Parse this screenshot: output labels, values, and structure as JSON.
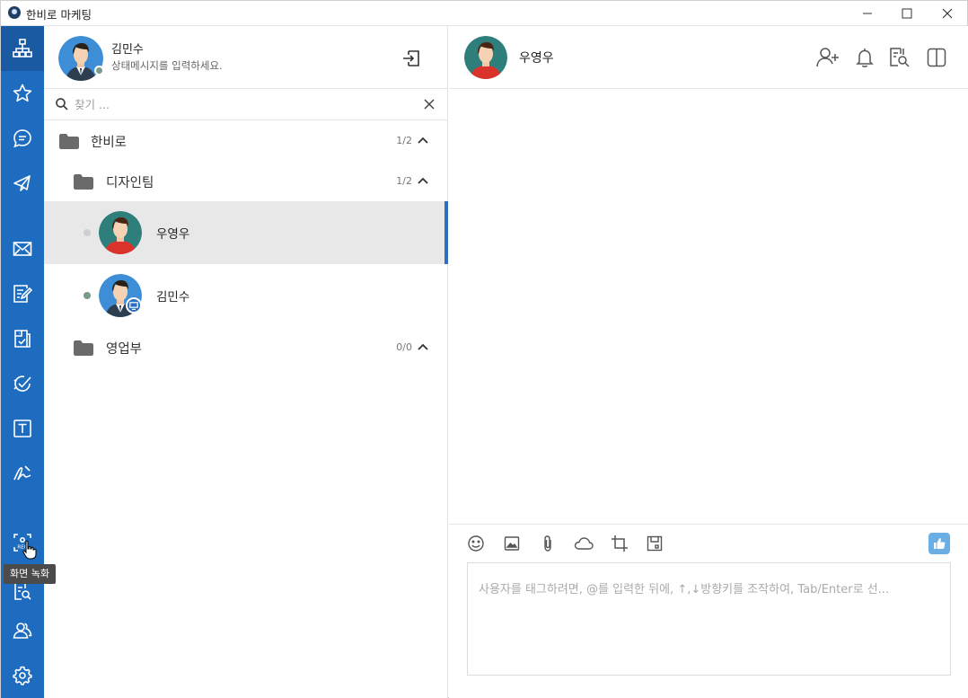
{
  "window": {
    "title": "한비로 마케팅",
    "controls": [
      "minimize-icon",
      "maximize-icon",
      "close-icon"
    ]
  },
  "rail": {
    "items": [
      {
        "name": "org-chart-icon",
        "active": true
      },
      {
        "name": "star-icon"
      },
      {
        "name": "chat-icon"
      },
      {
        "name": "send-icon"
      },
      {
        "name": "mail-icon"
      },
      {
        "name": "board-icon"
      },
      {
        "name": "approval-icon"
      },
      {
        "name": "task-icon"
      },
      {
        "name": "text-icon"
      },
      {
        "name": "signature-icon"
      },
      {
        "name": "screen-record-icon"
      },
      {
        "name": "search-doc-icon"
      },
      {
        "name": "users-icon"
      },
      {
        "name": "settings-icon"
      }
    ],
    "tooltip": "화면 녹화"
  },
  "profile": {
    "name": "김민수",
    "status_message": "상태메시지를 입력하세요."
  },
  "search": {
    "placeholder": "찾기 ..."
  },
  "tree": {
    "groups": [
      {
        "label": "한비로",
        "count": "1/2",
        "expanded": true
      },
      {
        "label": "디자인팀",
        "count": "1/2",
        "expanded": true
      },
      {
        "label": "영업부",
        "count": "0/0",
        "expanded": true
      }
    ],
    "users": [
      {
        "name": "우영우",
        "presence": "offline",
        "selected": true
      },
      {
        "name": "김민수",
        "presence": "online",
        "selected": false
      }
    ]
  },
  "chat": {
    "title": "우영우",
    "header_icons": [
      "add-user-icon",
      "bell-icon",
      "search-history-icon",
      "split-view-icon"
    ],
    "toolbar_icons": [
      "emoji-icon",
      "image-icon",
      "attachment-icon",
      "cloud-icon",
      "crop-icon",
      "save-icon"
    ],
    "composer_placeholder": "사용자를 태그하려면, @를 입력한 뒤에, ↑,↓방향키를 조작하여, Tab/Enter로 선..."
  },
  "colors": {
    "rail": "#1e6cc0",
    "rail_active": "#1a5aa3",
    "selected_row": "#e8e8e8",
    "accent": "#2d6fc0"
  }
}
